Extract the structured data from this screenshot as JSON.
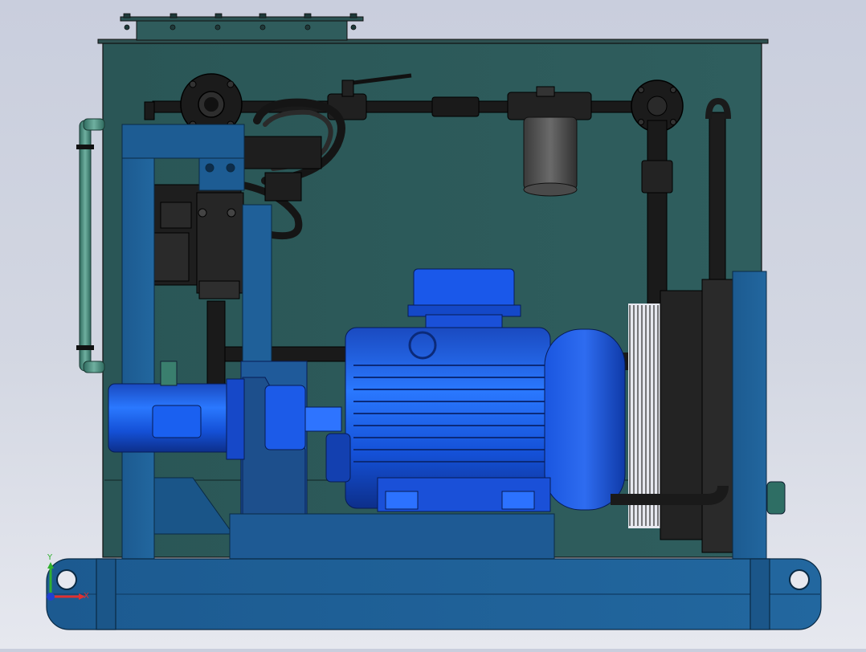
{
  "viewport": {
    "background_top": "#c9cedd",
    "background_bottom": "#e6e8ef"
  },
  "colors": {
    "tank": "#2c5a5a",
    "frame": "#1f5f96",
    "motor": "#1450d6",
    "pipe": "#1a1a1a",
    "pipe_green": "#3f7f72",
    "cooler": "#232323"
  },
  "triad": {
    "x_label": "X",
    "y_label": "Y",
    "x_color": "#e03030",
    "y_color": "#30b030",
    "z_color": "#2040d0"
  }
}
